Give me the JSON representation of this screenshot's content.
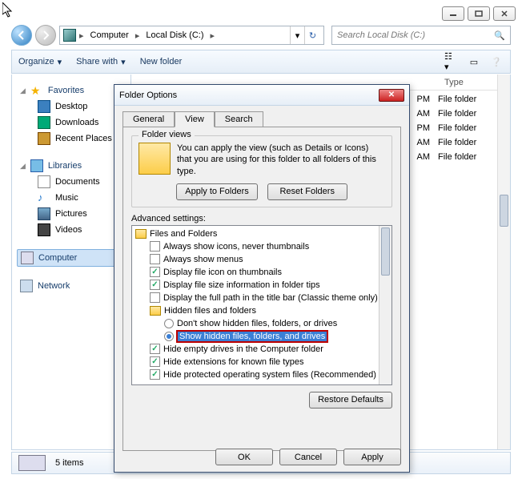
{
  "window": {
    "minimize": "_",
    "maximize": "□",
    "close": "×"
  },
  "nav": {
    "crumbs": [
      "Computer",
      "Local Disk (C:)"
    ],
    "search_placeholder": "Search Local Disk (C:)"
  },
  "toolbar": {
    "organize": "Organize",
    "share": "Share with",
    "newfolder": "New folder"
  },
  "navpanel": {
    "favorites": {
      "label": "Favorites",
      "items": [
        "Desktop",
        "Downloads",
        "Recent Places"
      ]
    },
    "libraries": {
      "label": "Libraries",
      "items": [
        "Documents",
        "Music",
        "Pictures",
        "Videos"
      ]
    },
    "computer": "Computer",
    "network": "Network"
  },
  "list": {
    "col_type": "Type",
    "rows": [
      {
        "time": "PM",
        "type": "File folder"
      },
      {
        "time": "AM",
        "type": "File folder"
      },
      {
        "time": "PM",
        "type": "File folder"
      },
      {
        "time": "AM",
        "type": "File folder"
      },
      {
        "time": "AM",
        "type": "File folder"
      }
    ]
  },
  "status": {
    "count": "5 items"
  },
  "dialog": {
    "title": "Folder Options",
    "tabs": {
      "general": "General",
      "view": "View",
      "search": "Search"
    },
    "fv": {
      "legend": "Folder views",
      "text": "You can apply the view (such as Details or Icons) that you are using for this folder to all folders of this type.",
      "apply": "Apply to Folders",
      "reset": "Reset Folders"
    },
    "adv_label": "Advanced settings:",
    "tree": {
      "root1": "Files and Folders",
      "n1": "Always show icons, never thumbnails",
      "n2": "Always show menus",
      "n3": "Display file icon on thumbnails",
      "n4": "Display file size information in folder tips",
      "n5": "Display the full path in the title bar (Classic theme only)",
      "root2": "Hidden files and folders",
      "r1": "Don't show hidden files, folders, or drives",
      "r2": "Show hidden files, folders, and drives",
      "n6": "Hide empty drives in the Computer folder",
      "n7": "Hide extensions for known file types",
      "n8": "Hide protected operating system files (Recommended)"
    },
    "restore": "Restore Defaults",
    "ok": "OK",
    "cancel": "Cancel",
    "apply": "Apply"
  }
}
